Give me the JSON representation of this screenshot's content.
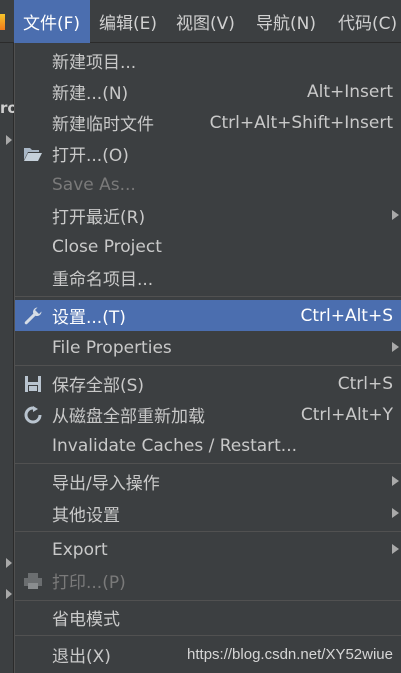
{
  "menubar": {
    "items": [
      {
        "label": "文件(F)",
        "active": true
      },
      {
        "label": "编辑(E)"
      },
      {
        "label": "视图(V)"
      },
      {
        "label": "导航(N)"
      },
      {
        "label": "代码(C)"
      }
    ],
    "left_fragment": "ro"
  },
  "file_menu": {
    "new_project": "新建项目...",
    "new": {
      "label": "新建...(N)",
      "shortcut": "Alt+Insert"
    },
    "new_scratch": {
      "label": "新建临时文件",
      "shortcut": "Ctrl+Alt+Shift+Insert"
    },
    "open": {
      "label": "打开...(O)",
      "icon": "folder-open-icon"
    },
    "save_as": {
      "label": "Save As...",
      "disabled": true
    },
    "open_recent": {
      "label": "打开最近(R)",
      "submenu": true
    },
    "close_project": "Close Project",
    "rename_project": "重命名项目...",
    "settings": {
      "label": "设置...(T)",
      "shortcut": "Ctrl+Alt+S",
      "icon": "wrench-icon",
      "selected": true
    },
    "file_properties": {
      "label": "File Properties",
      "submenu": true
    },
    "save_all": {
      "label": "保存全部(S)",
      "shortcut": "Ctrl+S",
      "icon": "save-icon"
    },
    "reload_all": {
      "label": "从磁盘全部重新加载",
      "shortcut": "Ctrl+Alt+Y",
      "icon": "reload-icon"
    },
    "invalidate_caches": "Invalidate Caches / Restart...",
    "export_import": {
      "label": "导出/导入操作",
      "submenu": true
    },
    "other_settings": {
      "label": "其他设置",
      "submenu": true
    },
    "export": {
      "label": "Export",
      "submenu": true
    },
    "print": {
      "label": "打印...(P)",
      "disabled": true,
      "icon": "printer-icon"
    },
    "power_save": "省电模式",
    "exit": "退出(X)"
  },
  "watermark": "https://blog.csdn.net/XY52wiue",
  "colors": {
    "menu_bg": "#3c3f41",
    "selection": "#4b6eaf",
    "separator": "#515151",
    "text": "#c9c9c9",
    "disabled": "#7a7a7a"
  }
}
